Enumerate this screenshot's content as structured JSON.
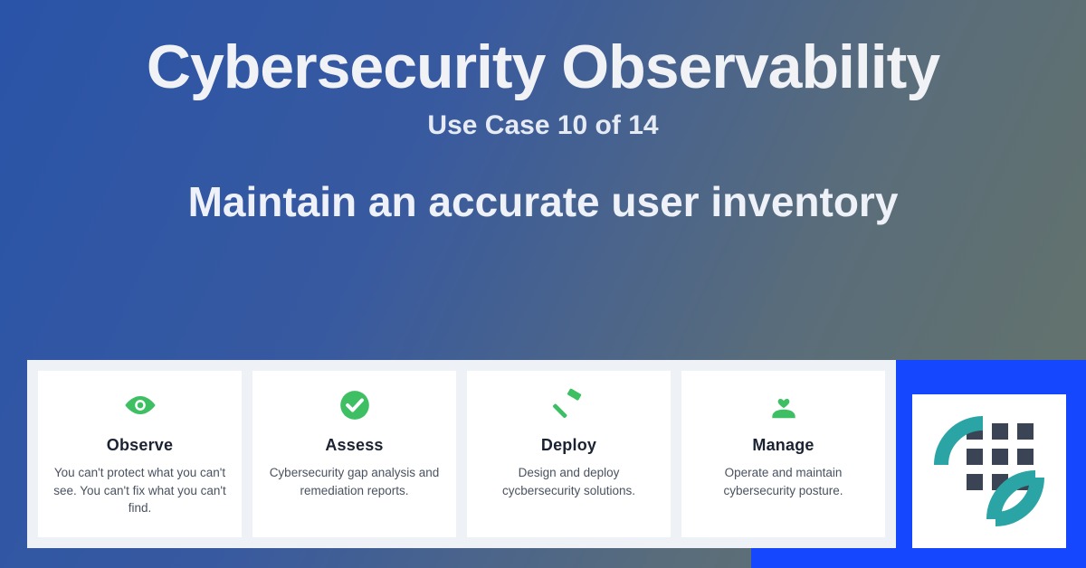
{
  "header": {
    "title": "Cybersecurity Observability",
    "subtitle": "Use Case 10 of 14"
  },
  "description": "Maintain an accurate user inventory",
  "cards": [
    {
      "icon": "eye-icon",
      "title": "Observe",
      "desc": "You can't protect what you can't see. You can't fix what you can't find."
    },
    {
      "icon": "check-icon",
      "title": "Assess",
      "desc": "Cybersecurity gap analysis and remediation reports."
    },
    {
      "icon": "hammer-icon",
      "title": "Deploy",
      "desc": "Design and deploy cycbersecurity solutions."
    },
    {
      "icon": "heart-hand-icon",
      "title": "Manage",
      "desc": "Operate and maintain cybersecurity posture."
    }
  ],
  "colors": {
    "icon_green": "#3fbf63",
    "logo_teal": "#2aa4a4",
    "logo_dark": "#3a4454"
  }
}
